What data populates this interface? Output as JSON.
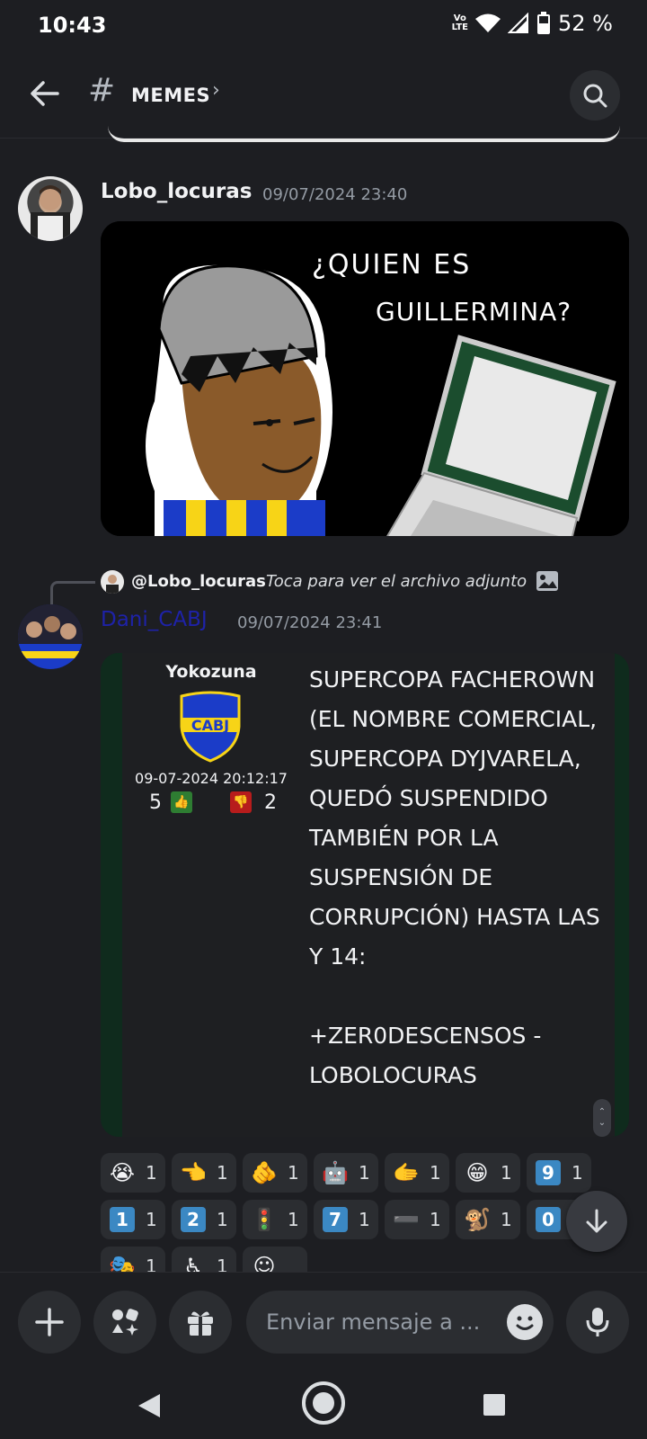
{
  "status": {
    "time": "10:43",
    "volte": "Vo\nLTE",
    "battery": "52 %"
  },
  "header": {
    "channel": "MEMES",
    "chevron": "›"
  },
  "messages": [
    {
      "username": "Lobo_locuras",
      "timestamp": "09/07/2024 23:40",
      "username_color": "#f2f3f5",
      "image_text_line1": "¿QUIEN ES",
      "image_text_line2": "GUILLERMINA?"
    },
    {
      "reply_to": "@Lobo_locuras",
      "reply_text": "Toca para ver el archivo adjunto",
      "username": "Dani_CABJ",
      "username_color": "#1e22a8",
      "timestamp": "09/07/2024 23:41",
      "embed": {
        "author": "Yokozuna",
        "shield_text": "CABJ",
        "date": "09-07-2024 20:12:17",
        "up_votes": "5",
        "down_votes": "2",
        "text": "SUPERCOPA FACHEROWN (EL NOMBRE COMERCIAL, SUPERCOPA DYJVARELA, QUEDÓ SUSPENDIDO TAMBIÉN POR LA SUSPENSIÓN DE CORRUPCIÓN) HASTA LAS Y 14:\n\n+ZER0DESCENSOS - LOBOLOCURAS"
      }
    }
  ],
  "reactions": [
    {
      "emoji": "😭",
      "count": "1"
    },
    {
      "emoji": "👈",
      "count": "1"
    },
    {
      "emoji": "🫵",
      "count": "1"
    },
    {
      "emoji": "🤖",
      "count": "1"
    },
    {
      "emoji": "🫱",
      "count": "1"
    },
    {
      "emoji": "😁",
      "count": "1"
    },
    {
      "emoji": "9",
      "count": "1",
      "keycap": true
    },
    {
      "emoji": "1",
      "count": "1",
      "keycap": true
    },
    {
      "emoji": "2",
      "count": "1",
      "keycap": true
    },
    {
      "emoji": "🚦",
      "count": "1"
    },
    {
      "emoji": "7",
      "count": "1",
      "keycap": true
    },
    {
      "emoji": "➖",
      "count": "1"
    },
    {
      "emoji": "🐒",
      "count": "1"
    },
    {
      "emoji": "0",
      "count": "1",
      "keycap": true
    },
    {
      "emoji": "🎭",
      "count": "1"
    },
    {
      "emoji": "♿",
      "count": "1"
    },
    {
      "emoji": "☺",
      "count": ""
    }
  ],
  "composer": {
    "placeholder": "Enviar mensaje a ..."
  },
  "colors": {
    "background": "#1d1e22",
    "pill": "#2b2d31",
    "accent_blue": "#3b88c3"
  }
}
